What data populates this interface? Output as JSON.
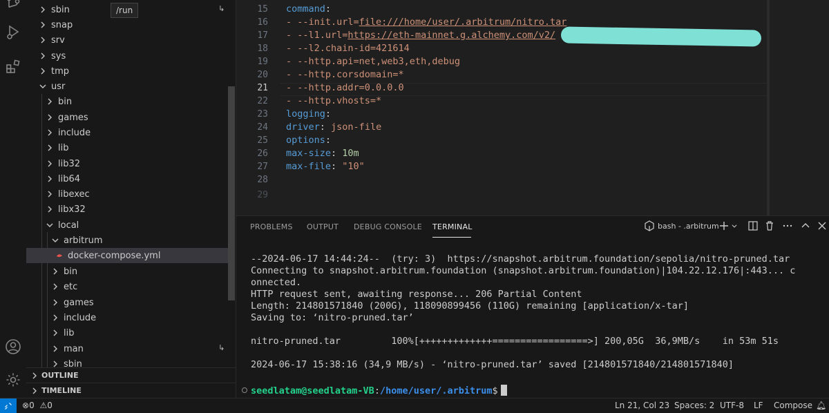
{
  "tooltip": "/run",
  "explorer": {
    "items": [
      {
        "label": "sbin",
        "expanded": false
      },
      {
        "label": "snap",
        "expanded": false
      },
      {
        "label": "srv",
        "expanded": false
      },
      {
        "label": "sys",
        "expanded": false
      },
      {
        "label": "tmp",
        "expanded": false
      },
      {
        "label": "usr",
        "expanded": true
      },
      {
        "label": "bin",
        "expanded": false
      },
      {
        "label": "games",
        "expanded": false
      },
      {
        "label": "include",
        "expanded": false
      },
      {
        "label": "lib",
        "expanded": false
      },
      {
        "label": "lib32",
        "expanded": false
      },
      {
        "label": "lib64",
        "expanded": false
      },
      {
        "label": "libexec",
        "expanded": false
      },
      {
        "label": "libx32",
        "expanded": false
      },
      {
        "label": "local",
        "expanded": true
      },
      {
        "label": "arbitrum",
        "expanded": true
      },
      {
        "label": "docker-compose.yml",
        "file": true
      },
      {
        "label": "bin",
        "expanded": false
      },
      {
        "label": "etc",
        "expanded": false
      },
      {
        "label": "games",
        "expanded": false
      },
      {
        "label": "include",
        "expanded": false
      },
      {
        "label": "lib",
        "expanded": false
      },
      {
        "label": "man",
        "expanded": false
      },
      {
        "label": "sbin",
        "expanded": false
      }
    ],
    "outline": "OUTLINE",
    "timeline": "TIMELINE"
  },
  "editor": {
    "line_numbers": [
      "15",
      "16",
      "17",
      "18",
      "19",
      "20",
      "21",
      "22",
      "23",
      "24",
      "25",
      "26",
      "27",
      "28",
      "29"
    ],
    "active_line": "21",
    "lines": [
      {
        "t1": "command",
        "t2": ":"
      },
      {
        "t1": "- --init.url=",
        "t2": "file:///home/user/.arbitrum/nitro.tar"
      },
      {
        "t1": "- --l1.url=",
        "t2": "https://eth-mainnet.g.alchemy.com/v2/"
      },
      {
        "t1": "- --l2.chain-id=421614"
      },
      {
        "t1": "- --http.api=net,web3,eth,debug"
      },
      {
        "t1": "- --http.corsdomain=*"
      },
      {
        "t1": "- --http.addr=0.0.0.0"
      },
      {
        "t1": "- --http.vhosts=*"
      },
      {
        "t1": "logging",
        "t2": ":"
      },
      {
        "t1": "driver",
        "t2": ": ",
        "t3": "json-file"
      },
      {
        "t1": "options",
        "t2": ":"
      },
      {
        "t1": "max-size",
        "t2": ": ",
        "t3": "10m"
      },
      {
        "t1": "max-file",
        "t2": ": ",
        "t3": "\"10\""
      }
    ]
  },
  "panel": {
    "tabs": [
      "PROBLEMS",
      "OUTPUT",
      "DEBUG CONSOLE",
      "TERMINAL"
    ],
    "active_tab": "TERMINAL",
    "terminal_name": "bash - .arbitrum",
    "terminal_lines": [
      "--2024-06-17 14:44:24--  (try: 3)  https://snapshot.arbitrum.foundation/sepolia/nitro-pruned.tar",
      "Connecting to snapshot.arbitrum.foundation (snapshot.arbitrum.foundation)|104.22.12.176|:443... c",
      "onnected.",
      "HTTP request sent, awaiting response... 206 Partial Content",
      "Length: 214801571840 (200G), 118090899456 (110G) remaining [application/x-tar]",
      "Saving to: ‘nitro-pruned.tar’",
      "",
      "nitro-pruned.tar         100%[+++++++++++++=================>] 200,05G  36,9MB/s    in 53m 51s",
      "",
      "2024-06-17 15:38:16 (34,9 MB/s) - ‘nitro-pruned.tar’ saved [214801571840/214801571840]"
    ],
    "prompt_user": "seedlatam@seedlatam-VB",
    "prompt_sep": ":",
    "prompt_path": "/home/user/.arbitrum",
    "prompt_end": "$"
  },
  "status": {
    "problems": "0",
    "warnings": "0",
    "position": "Ln 21, Col 23",
    "spaces": "Spaces: 2",
    "encoding": "UTF-8",
    "eol": "LF",
    "language": "Compose"
  },
  "colors": {
    "accent": "#0078d4",
    "keyword": "#569cd6",
    "string": "#ce9178",
    "number": "#b5cea8",
    "prompt_user": "#23d18b",
    "prompt_path": "#3b8eea"
  }
}
